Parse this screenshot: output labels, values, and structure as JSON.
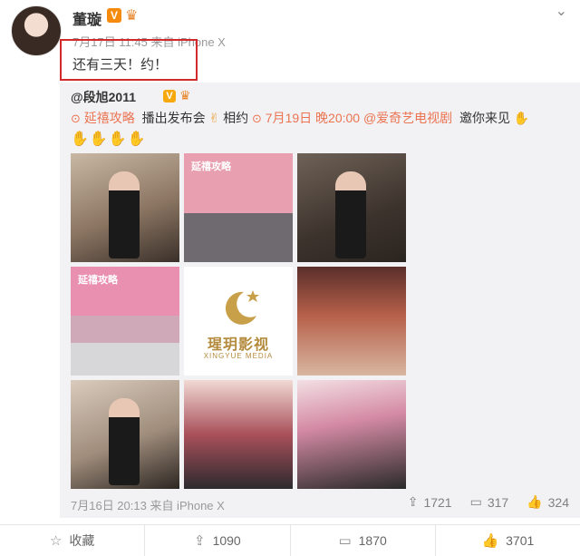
{
  "post": {
    "author": "董璇",
    "verified_badge": "V",
    "meta": "7月17日 11:45 来自 iPhone X",
    "text": "还有三天！约！"
  },
  "repost": {
    "author": "@段旭2011",
    "verified_badge": "V",
    "topic": "延禧攻略",
    "line1_mid": "播出发布会",
    "line1_after": "相约",
    "date_link": "7月19日 晚20:00",
    "mention": "@爱奇艺电视剧",
    "invite": "邀你来见",
    "photos": {
      "banner1": "延禧攻略",
      "banner2": "延禧攻略",
      "logo_cn": "瑆玥影视",
      "logo_en": "XINGYUE MEDIA"
    },
    "meta": "7月16日 20:13 来自 iPhone X",
    "reposts": "1721",
    "comments": "317",
    "likes": "324"
  },
  "actions": {
    "favorite": "收藏",
    "repost": "1090",
    "comment": "1870",
    "like": "3701"
  },
  "icons": [
    "chevron-down-icon",
    "crown-icon",
    "location-icon",
    "clap-icon",
    "repost-icon",
    "comment-icon",
    "like-icon",
    "star-icon"
  ],
  "colors": {
    "highlight": "#d22a2a",
    "link": "#eb7350",
    "verified": "#f68a0c",
    "repost_bg": "#f2f2f5"
  }
}
